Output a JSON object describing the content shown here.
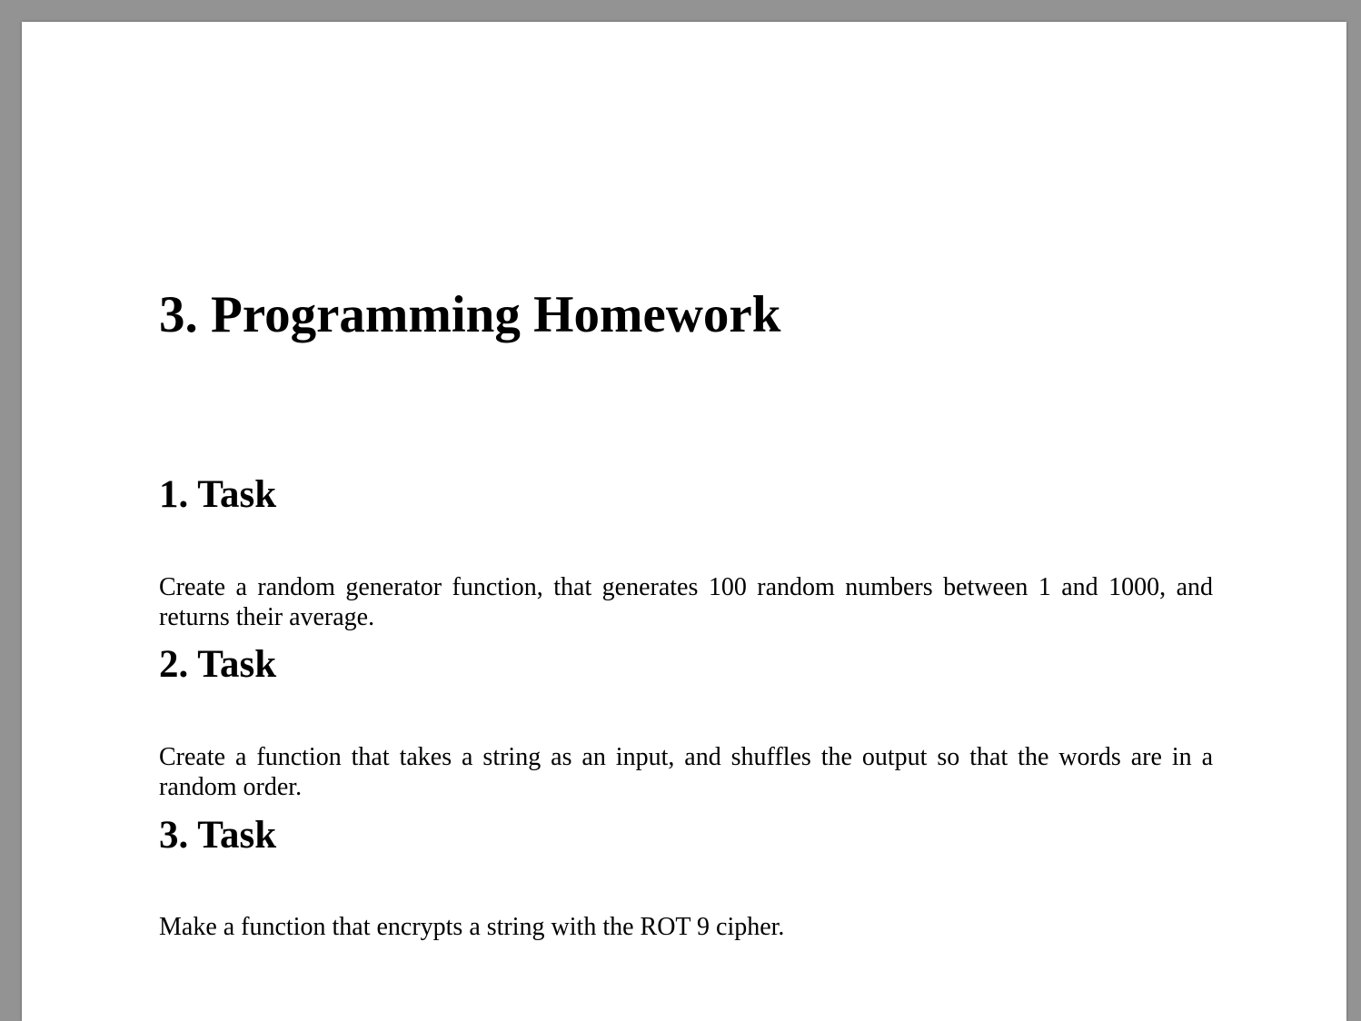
{
  "document": {
    "title": "3. Programming Homework",
    "tasks": [
      {
        "heading": "1. Task",
        "text": "Create a random generator function, that generates 100 random numbers between 1 and 1000, and returns their average."
      },
      {
        "heading": "2. Task",
        "text": "Create a function that takes a string as an input, and shuffles the output so that the words are in a random order."
      },
      {
        "heading": "3. Task",
        "text": "Make a function that encrypts a string with the ROT 9 cipher."
      }
    ]
  }
}
